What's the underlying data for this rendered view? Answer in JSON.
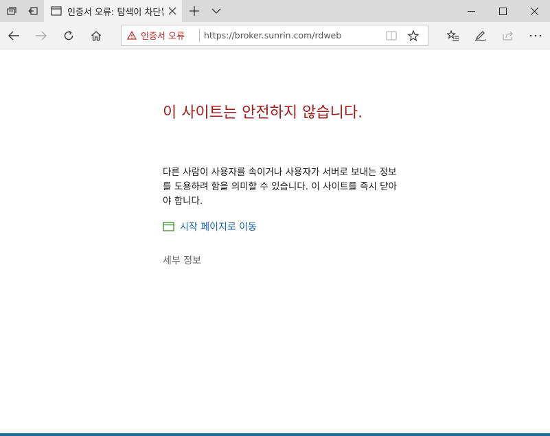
{
  "tab": {
    "title": "인증서 오류: 탐색이 차단됨",
    "icon": "page-icon"
  },
  "titlebar": {
    "set_aside_icon": "tabs-aside-icon",
    "back_tabs_icon": "restore-tabs-icon",
    "new_tab_icon": "plus-icon",
    "tab_list_icon": "chevron-down-icon"
  },
  "window_controls": [
    "minimize-icon",
    "maximize-icon",
    "close-icon"
  ],
  "address_bar": {
    "warning_label": "인증서 오류",
    "url": "https://broker.sunrin.com/rdweb",
    "warning_color": "#c4282d"
  },
  "page": {
    "heading": "이 사이트는 안전하지 않습니다.",
    "message": "다른 사람이 사용자를 속이거나 사용자가 서버로 보내는 정보를 도용하려 함을 의미할 수 있습니다. 이 사이트를 즉시 닫아야 합니다.",
    "start_link": "시작 페이지로 이동",
    "details_link": "세부 정보",
    "heading_color": "#a51b1b",
    "link_color": "#1a64b4"
  }
}
